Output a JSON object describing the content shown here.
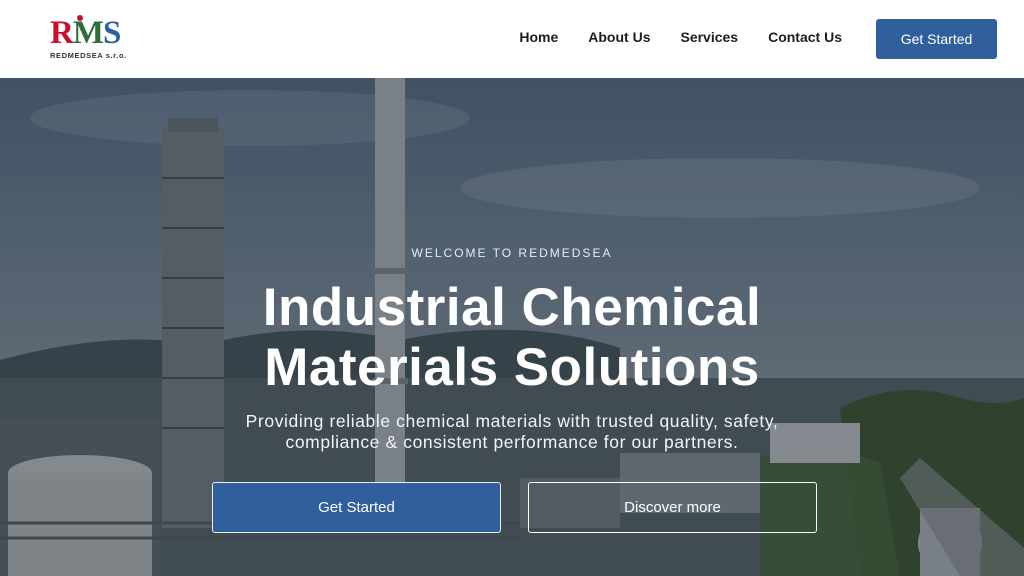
{
  "header": {
    "logo": {
      "mark": "RMS",
      "subtitle": "REDMEDSEA s.r.o."
    },
    "nav": [
      {
        "label": "Home"
      },
      {
        "label": "About Us"
      },
      {
        "label": "Services"
      },
      {
        "label": "Contact Us"
      }
    ],
    "cta_label": "Get Started"
  },
  "hero": {
    "eyebrow": "WELCOME TO REDMEDSEA",
    "title_line1": "Industrial Chemical",
    "title_line2": "Materials Solutions",
    "subtitle_line1": "Providing reliable chemical materials with trusted quality, safety,",
    "subtitle_line2": "compliance & consistent performance for our partners.",
    "primary_label": "Get Started",
    "secondary_label": "Discover more"
  },
  "colors": {
    "brand_blue": "#2f5f9d",
    "logo_red": "#c8102e",
    "logo_green": "#2d6e3a",
    "logo_blue": "#2a5ea8"
  }
}
